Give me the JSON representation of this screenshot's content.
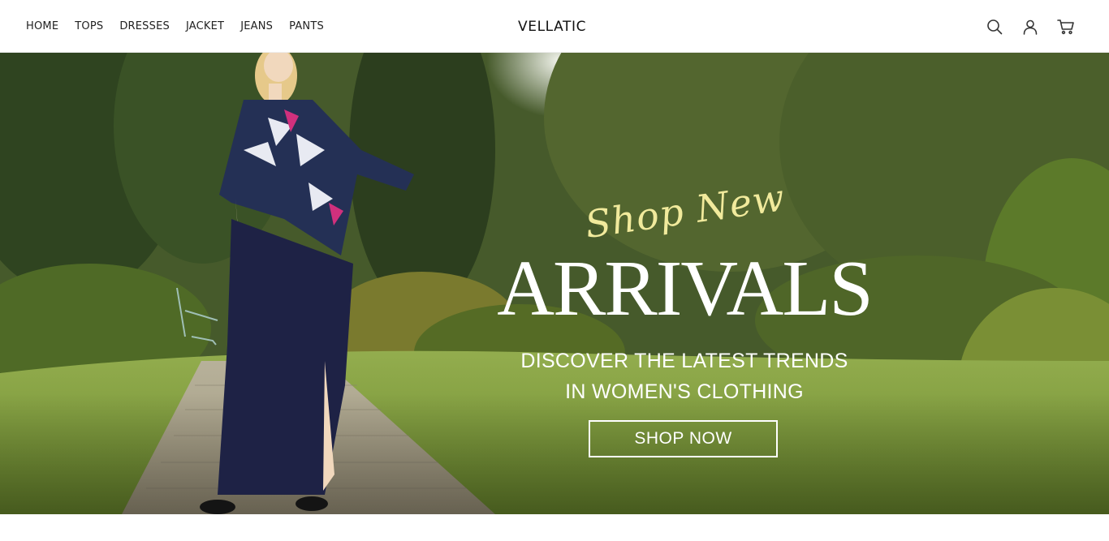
{
  "header": {
    "nav": [
      {
        "label": "HOME"
      },
      {
        "label": "TOPS"
      },
      {
        "label": "DRESSES"
      },
      {
        "label": "JACKET"
      },
      {
        "label": "JEANS"
      },
      {
        "label": "PANTS"
      }
    ],
    "logo": "VELLATIC",
    "icons": [
      "search-icon",
      "account-icon",
      "cart-icon"
    ]
  },
  "hero": {
    "script_text": "Shop New",
    "headline": "ARRIVALS",
    "subtitle_line1": "DISCOVER THE LATEST TRENDS",
    "subtitle_line2": "IN WOMEN'S CLOTHING",
    "cta_label": "SHOP NOW"
  },
  "colors": {
    "header_bg": "#ffffff",
    "text_dark": "#222222",
    "script_accent": "#f1ea9c",
    "hero_text": "#ffffff"
  }
}
